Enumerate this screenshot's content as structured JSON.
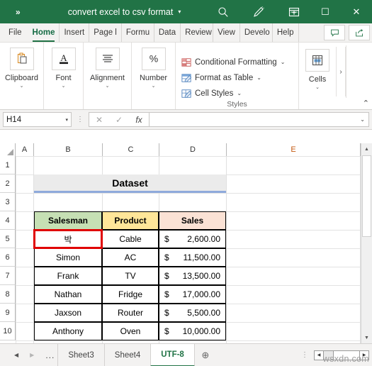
{
  "titlebar": {
    "quick_access": "»",
    "document_title": "convert excel to csv format",
    "caret": "▾",
    "icons": [
      "search-icon",
      "draw-icon",
      "ribbon-display-icon"
    ],
    "minimize": "─",
    "maximize": "☐",
    "close": "✕"
  },
  "ribbon_tabs": [
    {
      "label": "File",
      "active": false
    },
    {
      "label": "Home",
      "active": true
    },
    {
      "label": "Insert",
      "active": false
    },
    {
      "label": "Page l",
      "active": false
    },
    {
      "label": "Formu",
      "active": false
    },
    {
      "label": "Data",
      "active": false
    },
    {
      "label": "Review",
      "active": false
    },
    {
      "label": "View",
      "active": false
    },
    {
      "label": "Develo",
      "active": false
    },
    {
      "label": "Help",
      "active": false
    }
  ],
  "ribbon_right_buttons": [
    "comments-icon",
    "share-icon"
  ],
  "ribbon_groups": [
    {
      "label": "Clipboard",
      "icon": "clipboard-icon",
      "caret": "⌄"
    },
    {
      "label": "Font",
      "icon": "font-icon",
      "caret": "⌄"
    },
    {
      "label": "Alignment",
      "icon": "alignment-icon",
      "caret": "⌄"
    },
    {
      "label": "Number",
      "icon": "percent-icon",
      "caret": "⌄"
    }
  ],
  "styles_group": {
    "caption": "Styles",
    "items": [
      {
        "label": "Conditional Formatting",
        "caret": "⌄",
        "icon": "conditional-formatting-icon"
      },
      {
        "label": "Format as Table",
        "caret": "⌄",
        "icon": "format-as-table-icon"
      },
      {
        "label": "Cell Styles",
        "caret": "⌄",
        "icon": "cell-styles-icon"
      }
    ]
  },
  "cells_group": {
    "label": "Cells",
    "caret": "⌄",
    "icon": "cells-icon"
  },
  "ribbon_more": "›",
  "ribbon_collapse": "⌃",
  "formula_bar": {
    "name_box_value": "H14",
    "name_box_caret": "▾",
    "cancel": "✕",
    "enter": "✓",
    "insert_function": "fx",
    "formula_value": "",
    "expand_caret": "⌄"
  },
  "grid": {
    "column_headers": [
      "A",
      "B",
      "C",
      "D",
      "E"
    ],
    "highlighted_column": "E",
    "row_headers": [
      "1",
      "2",
      "3",
      "4",
      "5",
      "6",
      "7",
      "8",
      "9",
      "10"
    ],
    "title_cell": {
      "ref": "B2",
      "text": "Dataset"
    },
    "table_headers": [
      "Salesman",
      "Product",
      "Sales"
    ],
    "table_header_colors": [
      "#c6e0b4",
      "#ffe699",
      "#fbe2d5"
    ],
    "rows": [
      {
        "salesman": "박",
        "product": "Cable",
        "currency": "$",
        "sales": "2,600.00",
        "selected": true
      },
      {
        "salesman": "Simon",
        "product": "AC",
        "currency": "$",
        "sales": "11,500.00",
        "selected": false
      },
      {
        "salesman": "Frank",
        "product": "TV",
        "currency": "$",
        "sales": "13,500.00",
        "selected": false
      },
      {
        "salesman": "Nathan",
        "product": "Fridge",
        "currency": "$",
        "sales": "17,000.00",
        "selected": false
      },
      {
        "salesman": "Jaxson",
        "product": "Router",
        "currency": "$",
        "sales": "5,500.00",
        "selected": false
      },
      {
        "salesman": "Anthony",
        "product": "Oven",
        "currency": "$",
        "sales": "10,000.00",
        "selected": false
      }
    ],
    "selection_border_color": "#e00000",
    "selected_cell_ref": "B5"
  },
  "scrollbars": {
    "v_up": "▲",
    "v_down": "▼",
    "h_left": "◀",
    "h_right": "▶"
  },
  "tabbar": {
    "prev": "◀",
    "next": "▶",
    "ellipsis": "...",
    "sheets": [
      {
        "label": "Sheet3",
        "active": false
      },
      {
        "label": "Sheet4",
        "active": false
      },
      {
        "label": "UTF-8",
        "active": true
      }
    ],
    "add_sheet": "⊕",
    "dots": "⋮"
  },
  "watermark": "wsxdn.com"
}
